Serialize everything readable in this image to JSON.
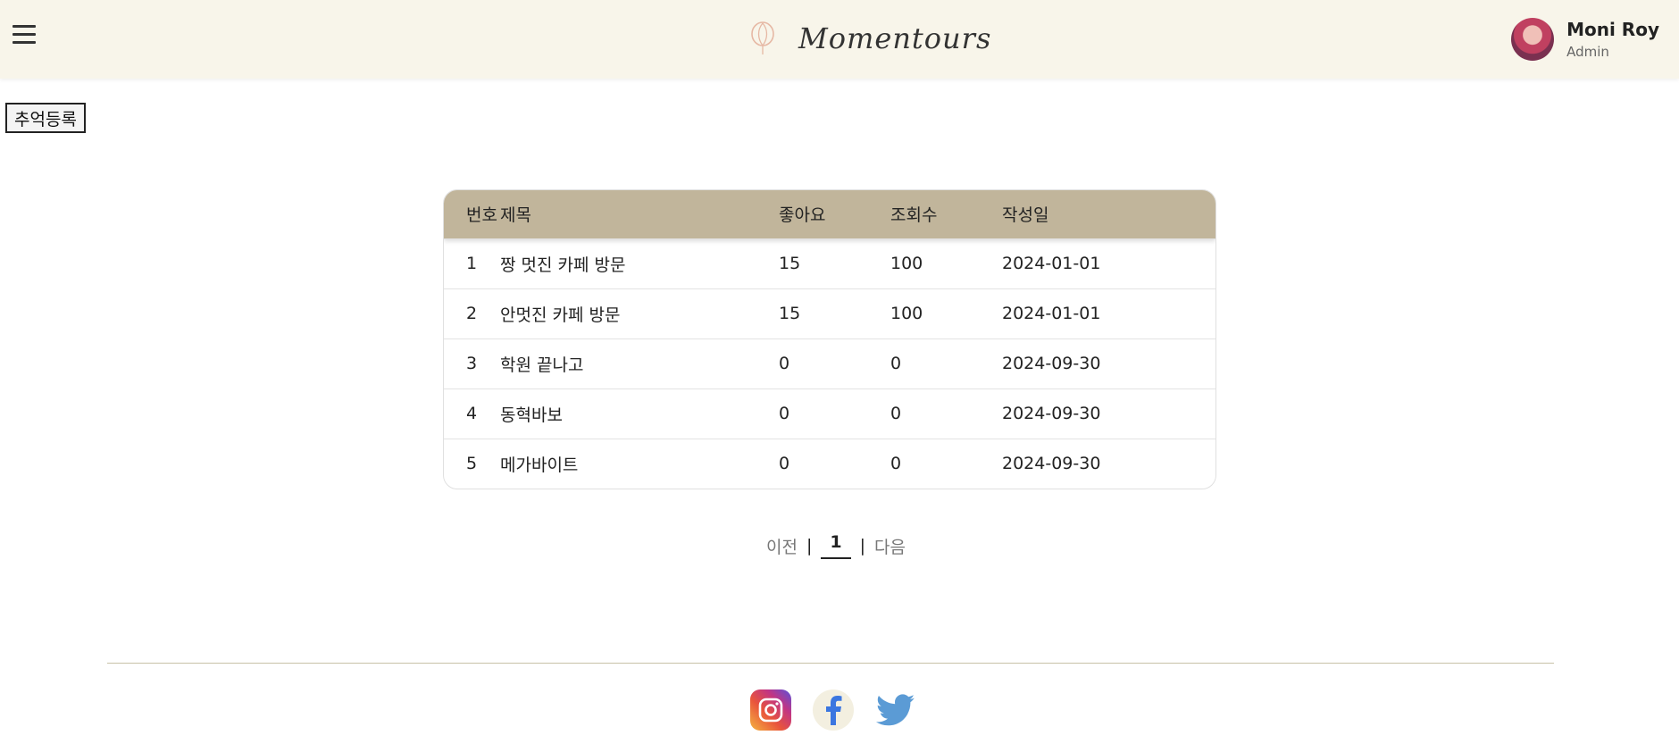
{
  "header": {
    "menu_icon": "hamburger-menu-icon",
    "logo_text": "Momentours",
    "logo_icon": "balloon-pin-icon",
    "user": {
      "name": "Moni Roy",
      "role": "Admin"
    }
  },
  "actions": {
    "register_label": "추억등록"
  },
  "board": {
    "columns": [
      "번호",
      "제목",
      "좋아요",
      "조회수",
      "작성일"
    ],
    "rows": [
      {
        "no": "1",
        "title": "짱 멋진 카페 방문",
        "likes": "15",
        "views": "100",
        "date": "2024-01-01"
      },
      {
        "no": "2",
        "title": "안멋진 카페 방문",
        "likes": "15",
        "views": "100",
        "date": "2024-01-01"
      },
      {
        "no": "3",
        "title": "학원 끝나고",
        "likes": "0",
        "views": "0",
        "date": "2024-09-30"
      },
      {
        "no": "4",
        "title": "동혁바보",
        "likes": "0",
        "views": "0",
        "date": "2024-09-30"
      },
      {
        "no": "5",
        "title": "메가바이트",
        "likes": "0",
        "views": "0",
        "date": "2024-09-30"
      }
    ]
  },
  "pagination": {
    "prev": "이전",
    "separator": "|",
    "current": "1",
    "next": "다음"
  },
  "footer": {
    "social": [
      "instagram-icon",
      "facebook-icon",
      "twitter-icon"
    ]
  },
  "colors": {
    "header_bg": "#f8f5ea",
    "table_header_bg": "#c1b59b",
    "footer_line": "#c8c2a8"
  }
}
